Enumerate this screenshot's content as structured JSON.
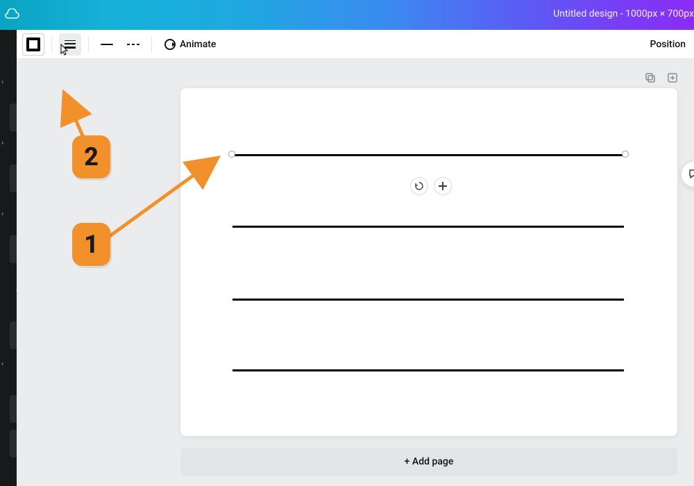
{
  "header": {
    "title": "Untitled design - 1000px × 700px"
  },
  "toolbar": {
    "animate_label": "Animate",
    "position_label": "Position"
  },
  "canvas": {
    "add_page_label": "+ Add page"
  },
  "annotations": {
    "badge1": "1",
    "badge2": "2"
  }
}
